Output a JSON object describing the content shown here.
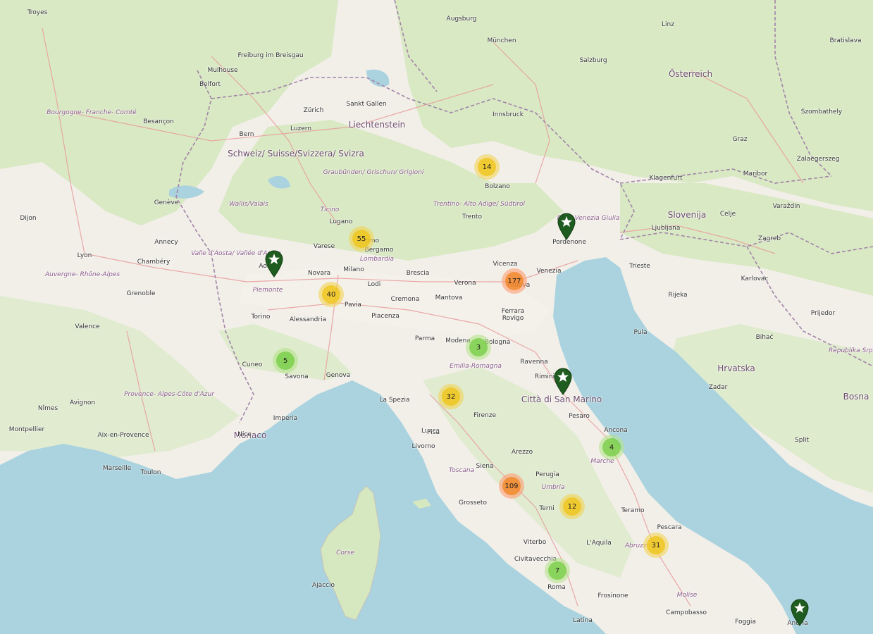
{
  "map": {
    "colors": {
      "land": "#f2efe9",
      "forest": "#cfe3b6",
      "water": "#aad3df",
      "border": "#a284a8",
      "road": "#e8a0a0",
      "cluster_small": "#6ecc39",
      "cluster_medium": "#f0c20c",
      "cluster_large": "#f18017",
      "pin": "#1f5c1f"
    },
    "countries": [
      {
        "name": "Österreich"
      },
      {
        "name": "Liechtenstein"
      },
      {
        "name": "Schweiz/ Suisse/Svizzera/ Svizra"
      },
      {
        "name": "Slovenija"
      },
      {
        "name": "Hrvatska"
      },
      {
        "name": "Bosna"
      },
      {
        "name": "Monaco"
      },
      {
        "name": "Città di San Marino"
      }
    ],
    "regions": [
      {
        "name": "Bourgogne- Franche- Comté"
      },
      {
        "name": "Auvergne- Rhône-Alpes"
      },
      {
        "name": "Provence- Alpes-Côte d'Azur"
      },
      {
        "name": "Graubünden/ Grischun/ Grigioni"
      },
      {
        "name": "Trentino- Alto Adige/ Südtirol"
      },
      {
        "name": "Valle d'Aosta/ Vallée d'Aoste"
      },
      {
        "name": "Lombardia"
      },
      {
        "name": "Piemonte"
      },
      {
        "name": "Emilia-Romagna"
      },
      {
        "name": "Toscana"
      },
      {
        "name": "Umbria"
      },
      {
        "name": "Marche"
      },
      {
        "name": "Abruzzo"
      },
      {
        "name": "Molise"
      },
      {
        "name": "Friuli-Venezia Giulia"
      },
      {
        "name": "Corse"
      },
      {
        "name": "Wallis/Valais"
      },
      {
        "name": "Ticino"
      },
      {
        "name": "Republika Srpska"
      }
    ],
    "cities": [
      {
        "name": "München"
      },
      {
        "name": "Augsburg"
      },
      {
        "name": "Salzburg"
      },
      {
        "name": "Linz"
      },
      {
        "name": "Bratislava"
      },
      {
        "name": "Graz"
      },
      {
        "name": "Klagenfurt"
      },
      {
        "name": "Maribor"
      },
      {
        "name": "Innsbruck"
      },
      {
        "name": "Zürich"
      },
      {
        "name": "Bern"
      },
      {
        "name": "Freiburg im Breisgau"
      },
      {
        "name": "Mulhouse"
      },
      {
        "name": "Besançon"
      },
      {
        "name": "Dijon"
      },
      {
        "name": "Lyon"
      },
      {
        "name": "Grenoble"
      },
      {
        "name": "Chambéry"
      },
      {
        "name": "Annecy"
      },
      {
        "name": "Genève"
      },
      {
        "name": "Torino"
      },
      {
        "name": "Milano"
      },
      {
        "name": "Novara"
      },
      {
        "name": "Bergamo"
      },
      {
        "name": "Brescia"
      },
      {
        "name": "Verona"
      },
      {
        "name": "Vicenza"
      },
      {
        "name": "Venezia"
      },
      {
        "name": "Padova"
      },
      {
        "name": "Trento"
      },
      {
        "name": "Bolzano"
      },
      {
        "name": "Cremona"
      },
      {
        "name": "Mantova"
      },
      {
        "name": "Piacenza"
      },
      {
        "name": "Parma"
      },
      {
        "name": "Modena"
      },
      {
        "name": "Bologna"
      },
      {
        "name": "Ferrara"
      },
      {
        "name": "Rovigo"
      },
      {
        "name": "Ravenna"
      },
      {
        "name": "Rimini"
      },
      {
        "name": "Genova"
      },
      {
        "name": "Savona"
      },
      {
        "name": "Cuneo"
      },
      {
        "name": "Alessandria"
      },
      {
        "name": "Pavia"
      },
      {
        "name": "Lodi"
      },
      {
        "name": "La Spezia"
      },
      {
        "name": "Lucca"
      },
      {
        "name": "Livorno"
      },
      {
        "name": "Pisa"
      },
      {
        "name": "Firenze"
      },
      {
        "name": "Siena"
      },
      {
        "name": "Arezzo"
      },
      {
        "name": "Perugia"
      },
      {
        "name": "Grosseto"
      },
      {
        "name": "Terni"
      },
      {
        "name": "Viterbo"
      },
      {
        "name": "Civitavecchia"
      },
      {
        "name": "Roma"
      },
      {
        "name": "Ancona"
      },
      {
        "name": "Pesaro"
      },
      {
        "name": "Teramo"
      },
      {
        "name": "Pescara"
      },
      {
        "name": "L'Aquila"
      },
      {
        "name": "Frosinone"
      },
      {
        "name": "Latina"
      },
      {
        "name": "Campobasso"
      },
      {
        "name": "Foggia"
      },
      {
        "name": "Andria"
      },
      {
        "name": "Trieste"
      },
      {
        "name": "Ljubljana"
      },
      {
        "name": "Zagreb"
      },
      {
        "name": "Rijeka"
      },
      {
        "name": "Karlovac"
      },
      {
        "name": "Zadar"
      },
      {
        "name": "Split"
      },
      {
        "name": "Pula"
      },
      {
        "name": "Bihać"
      },
      {
        "name": "Prijedor"
      },
      {
        "name": "Varaždin"
      },
      {
        "name": "Celje"
      },
      {
        "name": "Zalaegerszeg"
      },
      {
        "name": "Szombathely"
      },
      {
        "name": "Sankt Gallen"
      },
      {
        "name": "Luzern"
      },
      {
        "name": "Lugano"
      },
      {
        "name": "Varese"
      },
      {
        "name": "Como"
      },
      {
        "name": "Belfort"
      },
      {
        "name": "Nice"
      },
      {
        "name": "Marseille"
      },
      {
        "name": "Toulon"
      },
      {
        "name": "Avignon"
      },
      {
        "name": "Nîmes"
      },
      {
        "name": "Montpellier"
      },
      {
        "name": "Aix-en-Provence"
      },
      {
        "name": "Valence"
      },
      {
        "name": "Troyes"
      },
      {
        "name": "Imperia"
      },
      {
        "name": "Aosta"
      },
      {
        "name": "Pordenone"
      },
      {
        "name": "Ajaccio"
      }
    ],
    "clusters": [
      {
        "count": "14",
        "size": "medium"
      },
      {
        "count": "55",
        "size": "medium"
      },
      {
        "count": "40",
        "size": "medium"
      },
      {
        "count": "177",
        "size": "large"
      },
      {
        "count": "3",
        "size": "small"
      },
      {
        "count": "5",
        "size": "small"
      },
      {
        "count": "32",
        "size": "medium"
      },
      {
        "count": "4",
        "size": "small"
      },
      {
        "count": "109",
        "size": "large"
      },
      {
        "count": "12",
        "size": "medium"
      },
      {
        "count": "31",
        "size": "medium"
      },
      {
        "count": "7",
        "size": "small"
      }
    ],
    "pins": [
      {
        "icon": "star-icon"
      },
      {
        "icon": "star-icon"
      },
      {
        "icon": "star-icon"
      },
      {
        "icon": "star-icon"
      }
    ]
  }
}
